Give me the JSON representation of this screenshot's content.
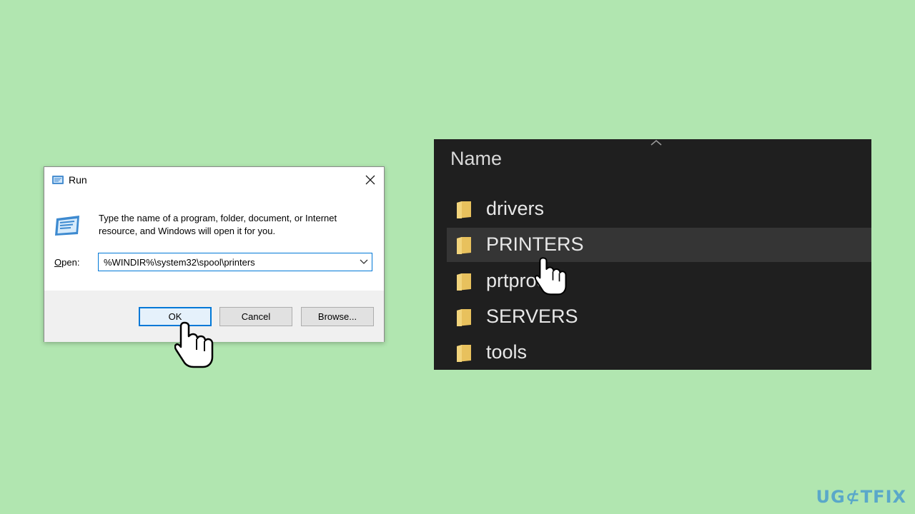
{
  "run_dialog": {
    "title": "Run",
    "close_glyph": "✕",
    "description": "Type the name of a program, folder, document, or Internet resource, and Windows will open it for you.",
    "open_label": "Open:",
    "open_value": "%WINDIR%\\system32\\spool\\printers",
    "buttons": {
      "ok": "OK",
      "cancel": "Cancel",
      "browse": "Browse..."
    },
    "accent_color": "#0078d7",
    "icons": {
      "title": "run-icon",
      "body": "run-icon",
      "dropdown": "chevron-down-icon",
      "close": "close-icon"
    }
  },
  "explorer": {
    "column_header": "Name",
    "items": [
      {
        "name": "drivers",
        "selected": false
      },
      {
        "name": "PRINTERS",
        "selected": true
      },
      {
        "name": "prtprocs",
        "selected": false
      },
      {
        "name": "SERVERS",
        "selected": false
      },
      {
        "name": "tools",
        "selected": false
      }
    ],
    "background_color": "#1f1f1f",
    "folder_color": "#e8c15d"
  },
  "watermark": {
    "text": "UG⊄TFIX"
  },
  "page": {
    "background_color": "#b1e6b0"
  }
}
